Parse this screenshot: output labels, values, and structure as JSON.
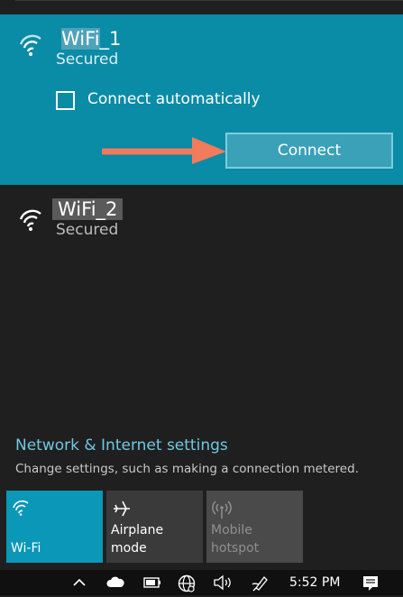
{
  "networks": [
    {
      "name_visible": "WiFi",
      "name_suffix": "_1",
      "status": "Secured",
      "icon": "wifi-signal-icon"
    },
    {
      "name_visible": "WiFi",
      "name_suffix": "_2",
      "status": "Secured",
      "icon": "wifi-signal-icon"
    }
  ],
  "connect_automatically_label": "Connect automatically",
  "connect_button_label": "Connect",
  "settings": {
    "link": "Network & Internet settings",
    "description": "Change settings, such as making a connection metered."
  },
  "quick_actions": [
    {
      "label": "Wi-Fi",
      "icon": "wifi-icon",
      "active": true
    },
    {
      "label": "Airplane mode",
      "icon": "airplane-icon",
      "active": false
    },
    {
      "label": "Mobile hotspot",
      "icon": "hotspot-icon",
      "active": false,
      "disabled": true
    }
  ],
  "taskbar": {
    "time": "5:52 PM",
    "icons": [
      "chevron-up-icon",
      "cloud-icon",
      "battery-icon",
      "globe-icon",
      "volume-icon",
      "pen-icon",
      "notification-icon"
    ]
  },
  "colors": {
    "accent": "#0a8ba6",
    "link": "#6fc8e3",
    "arrow": "#f07b5d",
    "background": "#1f1f1f"
  }
}
